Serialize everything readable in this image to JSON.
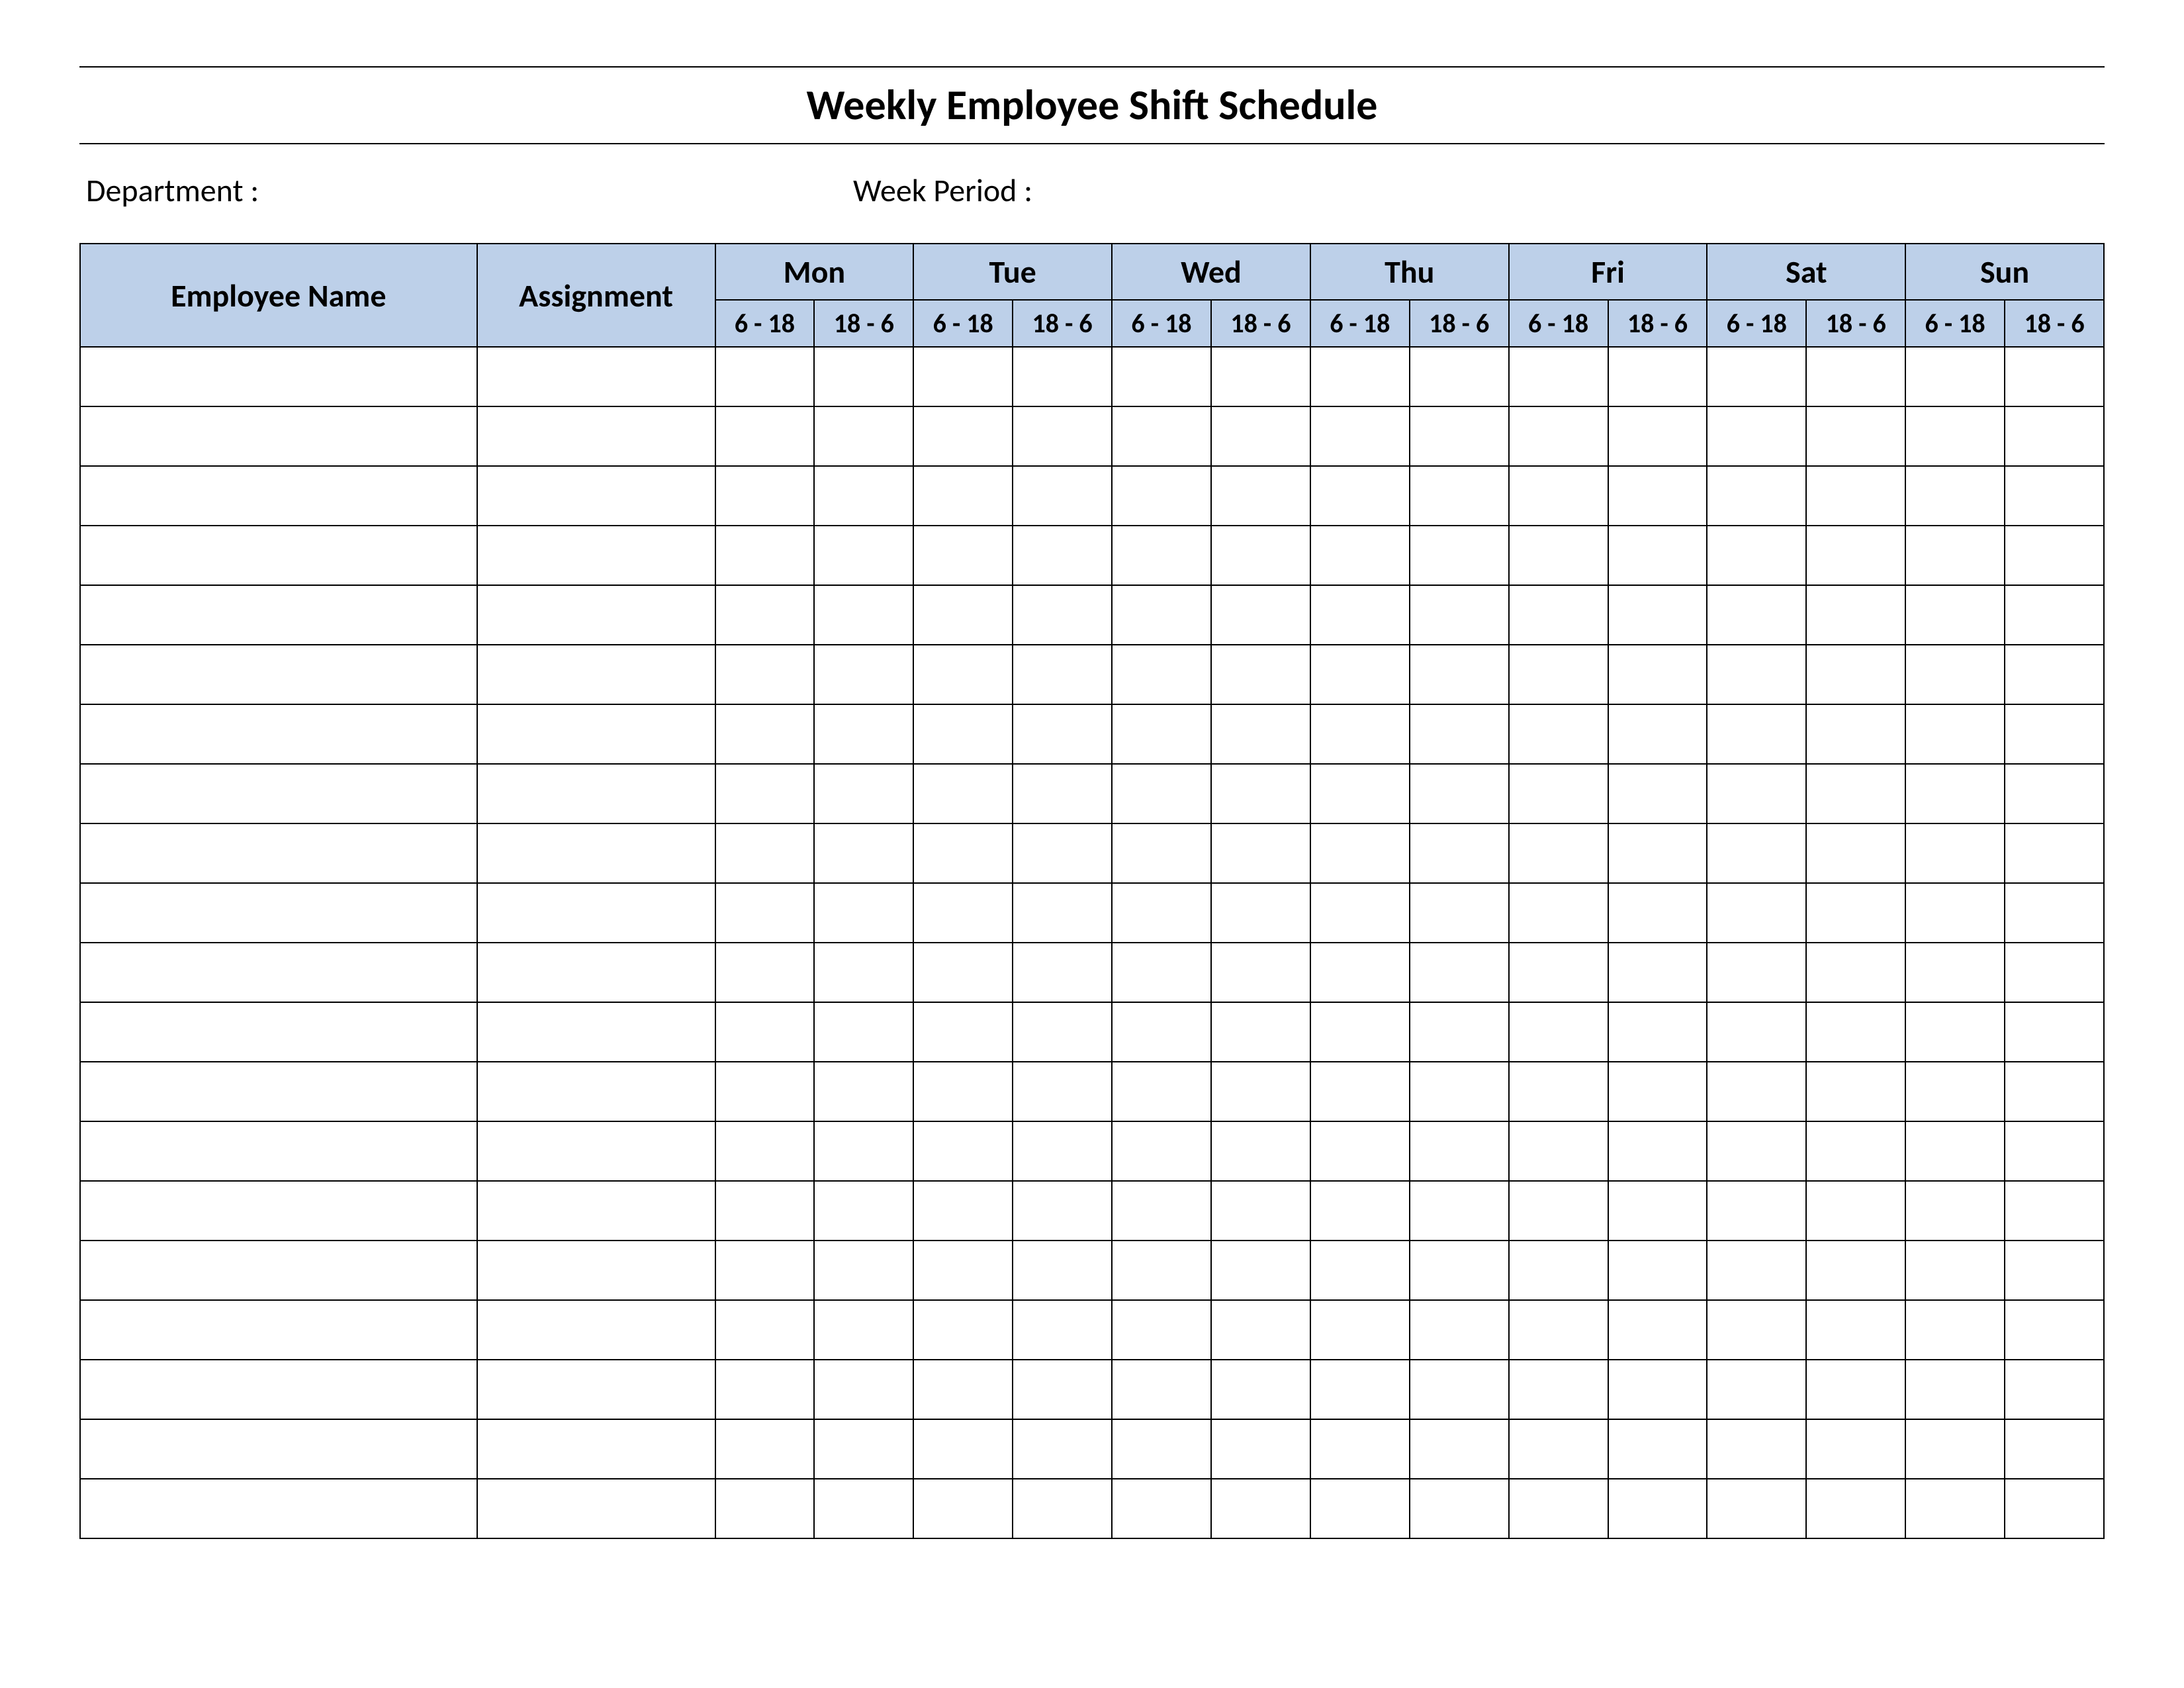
{
  "title": "Weekly Employee Shift Schedule",
  "meta": {
    "department_label": "Department :",
    "week_period_label": "Week  Period :"
  },
  "columns": {
    "employee": "Employee Name",
    "assignment": "Assignment"
  },
  "days": [
    {
      "name": "Mon",
      "shifts": [
        "6 - 18",
        "18 - 6"
      ]
    },
    {
      "name": "Tue",
      "shifts": [
        "6 - 18",
        "18 - 6"
      ]
    },
    {
      "name": "Wed",
      "shifts": [
        "6 - 18",
        "18 - 6"
      ]
    },
    {
      "name": "Thu",
      "shifts": [
        "6 - 18",
        "18 - 6"
      ]
    },
    {
      "name": "Fri",
      "shifts": [
        "6 - 18",
        "18 - 6"
      ]
    },
    {
      "name": "Sat",
      "shifts": [
        "6 - 18",
        "18 - 6"
      ]
    },
    {
      "name": "Sun",
      "shifts": [
        "6 - 18",
        "18 - 6"
      ]
    }
  ],
  "row_count": 20,
  "colors": {
    "header_bg": "#bdd0e9",
    "border": "#000000"
  }
}
